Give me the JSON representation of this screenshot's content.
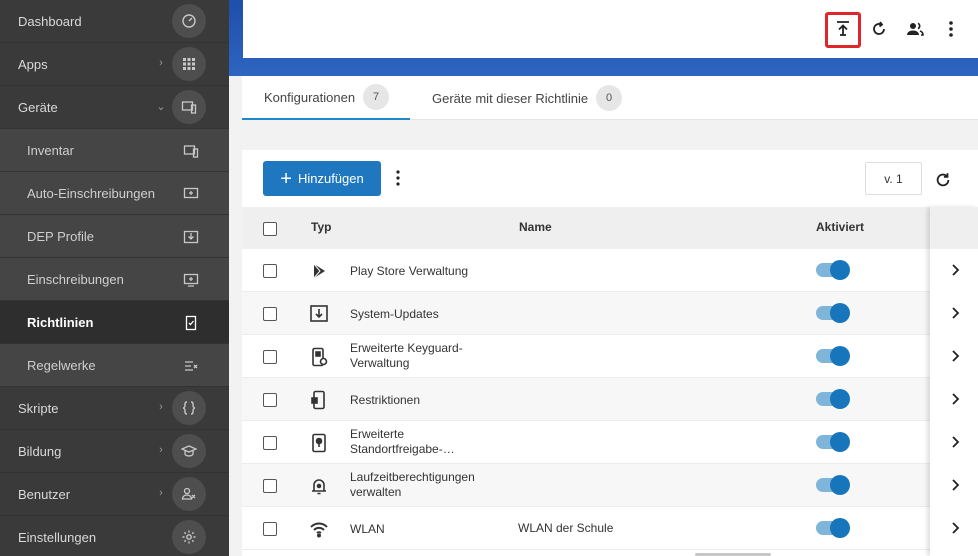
{
  "sidebar": {
    "items": [
      {
        "label": "Dashboard",
        "icon": "speedometer-icon"
      },
      {
        "label": "Apps",
        "icon": "apps-grid-icon",
        "chevron": "right"
      },
      {
        "label": "Geräte",
        "icon": "devices-icon",
        "chevron": "down"
      },
      {
        "label": "Inventar",
        "icon": "inventory-devices-icon"
      },
      {
        "label": "Auto-Einschreibungen",
        "icon": "auto-enroll-icon"
      },
      {
        "label": "DEP Profile",
        "icon": "dep-download-icon"
      },
      {
        "label": "Einschreibungen",
        "icon": "enrollment-icon"
      },
      {
        "label": "Richtlinien",
        "icon": "policy-icon"
      },
      {
        "label": "Regelwerke",
        "icon": "rules-icon"
      },
      {
        "label": "Skripte",
        "icon": "code-braces-icon",
        "chevron": "right"
      },
      {
        "label": "Bildung",
        "icon": "graduation-cap-icon",
        "chevron": "right"
      },
      {
        "label": "Benutzer",
        "icon": "users-icon",
        "chevron": "right"
      },
      {
        "label": "Einstellungen",
        "icon": "gear-icon"
      }
    ]
  },
  "header": {
    "actions": [
      {
        "name": "publish-upload-icon"
      },
      {
        "name": "sync-icon"
      },
      {
        "name": "assign-users-icon"
      },
      {
        "name": "more-vertical-icon"
      }
    ]
  },
  "tabs": [
    {
      "label": "Konfigurationen",
      "count": "7"
    },
    {
      "label": "Geräte mit dieser Richtlinie",
      "count": "0"
    }
  ],
  "toolbar": {
    "add_label": "Hinzufügen",
    "version": "v. 1"
  },
  "table": {
    "columns": {
      "type": "Typ",
      "name": "Name",
      "enabled": "Aktiviert"
    },
    "rows": [
      {
        "type": "Play Store Verwaltung",
        "name": "",
        "enabled": true,
        "icon": "play-store-icon"
      },
      {
        "type": "System-Updates",
        "name": "",
        "enabled": true,
        "icon": "system-update-icon"
      },
      {
        "type": "Erweiterte Keyguard-\nVerwaltung",
        "name": "",
        "enabled": true,
        "icon": "keyguard-device-icon"
      },
      {
        "type": "Restriktionen",
        "name": "",
        "enabled": true,
        "icon": "restriction-device-icon"
      },
      {
        "type": "Erweiterte\nStandortfreigabe-…",
        "name": "",
        "enabled": true,
        "icon": "location-device-icon"
      },
      {
        "type": "Laufzeitberechtigungen\nverwalten",
        "name": "",
        "enabled": true,
        "icon": "permission-bell-icon"
      },
      {
        "type": "WLAN",
        "name": "WLAN der Schule",
        "enabled": true,
        "icon": "wifi-icon"
      }
    ]
  },
  "colors": {
    "sidebar_bg": "#3a3a3a",
    "header_blue": "#2d65c0",
    "accent": "#1f78bf",
    "highlight": "#e0262b"
  }
}
